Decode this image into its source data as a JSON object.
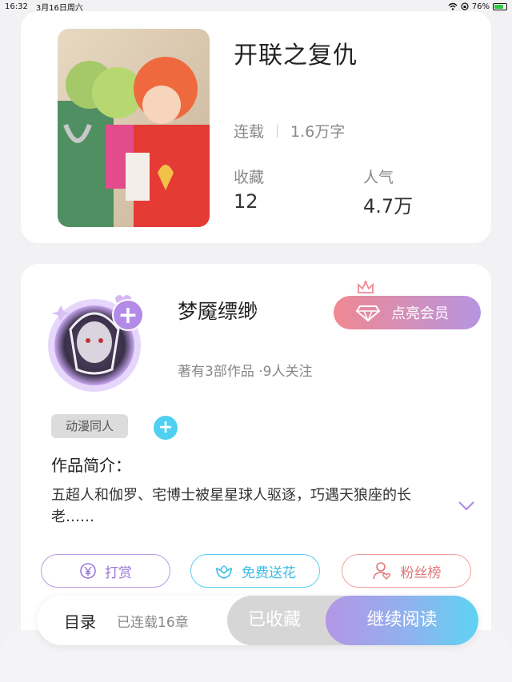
{
  "status_bar": {
    "time": "16:32",
    "date": "3月16日周六",
    "battery": "76%"
  },
  "book": {
    "title": "开联之复仇",
    "status": "连载",
    "word_count": "1.6万字",
    "favorites_label": "收藏",
    "favorites_value": "12",
    "popularity_label": "人气",
    "popularity_value": "4.7万"
  },
  "author": {
    "name": "梦魇缥缈",
    "vip_label": "点亮会员",
    "stats": "著有3部作品 ·9人关注",
    "tag": "动漫同人",
    "intro_title": "作品简介：",
    "intro_text": "五超人和伽罗、宅博士被星星球人驱逐，巧遇天狼座的长老……"
  },
  "actions": {
    "reward": "打赏",
    "flower": "免费送花",
    "fans": "粉丝榜"
  },
  "bottom_bar": {
    "toc": "目录",
    "chapter_count": "已连载16章",
    "collected": "已收藏",
    "continue": "继续阅读"
  },
  "colors": {
    "accent_purple": "#b48ae8",
    "accent_cyan": "#4fd0f0",
    "vip_pink": "#f08892"
  }
}
